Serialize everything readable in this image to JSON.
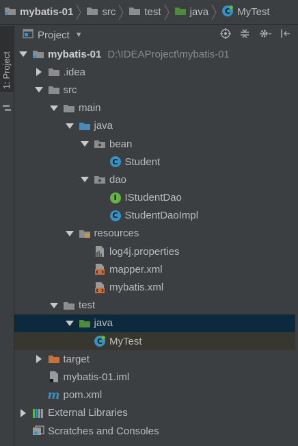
{
  "breadcrumb": [
    "mybatis-01",
    "src",
    "test",
    "java",
    "MyTest"
  ],
  "sidebar_tab": "1: Project",
  "panel": {
    "title": "Project"
  },
  "tree": [
    {
      "label": "mybatis-01",
      "path": "D:\\IDEAProject\\mybatis-01",
      "depth": 0,
      "arrow": "down",
      "icon": "module-folder",
      "bold": true
    },
    {
      "label": ".idea",
      "depth": 1,
      "arrow": "right",
      "icon": "folder"
    },
    {
      "label": "src",
      "depth": 1,
      "arrow": "down",
      "icon": "folder"
    },
    {
      "label": "main",
      "depth": 2,
      "arrow": "down",
      "icon": "folder"
    },
    {
      "label": "java",
      "depth": 3,
      "arrow": "down",
      "icon": "source-folder"
    },
    {
      "label": "bean",
      "depth": 4,
      "arrow": "down",
      "icon": "package"
    },
    {
      "label": "Student",
      "depth": 5,
      "arrow": "none",
      "icon": "class"
    },
    {
      "label": "dao",
      "depth": 4,
      "arrow": "down",
      "icon": "package"
    },
    {
      "label": "IStudentDao",
      "depth": 5,
      "arrow": "none",
      "icon": "interface"
    },
    {
      "label": "StudentDaoImpl",
      "depth": 5,
      "arrow": "none",
      "icon": "class"
    },
    {
      "label": "resources",
      "depth": 3,
      "arrow": "down",
      "icon": "resources-folder"
    },
    {
      "label": "log4j.properties",
      "depth": 4,
      "arrow": "none",
      "icon": "properties-file"
    },
    {
      "label": "mapper.xml",
      "depth": 4,
      "arrow": "none",
      "icon": "xml-file"
    },
    {
      "label": "mybatis.xml",
      "depth": 4,
      "arrow": "none",
      "icon": "xml-file"
    },
    {
      "label": "test",
      "depth": 2,
      "arrow": "down",
      "icon": "folder"
    },
    {
      "label": "java",
      "depth": 3,
      "arrow": "down",
      "icon": "test-folder",
      "state": "selected"
    },
    {
      "label": "MyTest",
      "depth": 4,
      "arrow": "none",
      "icon": "test-class",
      "state": "highlight"
    },
    {
      "label": "target",
      "depth": 1,
      "arrow": "right",
      "icon": "excluded-folder"
    },
    {
      "label": "mybatis-01.iml",
      "depth": 1,
      "arrow": "none",
      "icon": "iml-file"
    },
    {
      "label": "pom.xml",
      "depth": 1,
      "arrow": "none",
      "icon": "maven-file"
    },
    {
      "label": "External Libraries",
      "depth": 0,
      "arrow": "right",
      "icon": "libraries"
    },
    {
      "label": "Scratches and Consoles",
      "depth": 0,
      "arrow": "none",
      "icon": "scratches"
    }
  ],
  "colors": {
    "selection": "#0d293e",
    "highlight": "#37372f",
    "class": "#3592c4",
    "interface": "#62b543",
    "folder": "#8c8c8c",
    "source": "#4a8ab8",
    "test": "#4f8c3a",
    "excluded": "#c7703c"
  }
}
